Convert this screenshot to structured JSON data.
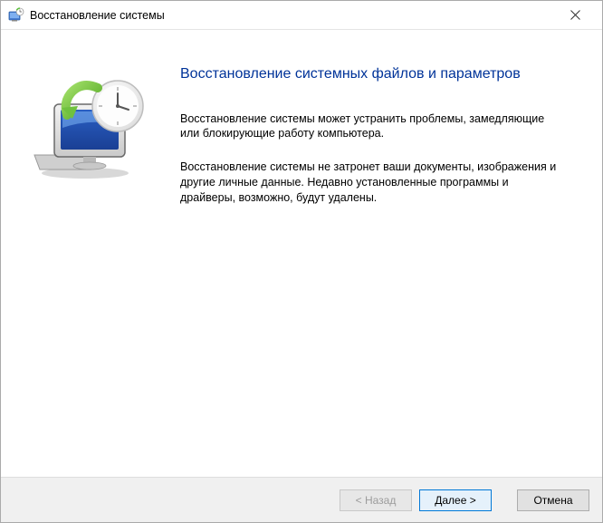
{
  "titlebar": {
    "text": "Восстановление системы"
  },
  "content": {
    "heading": "Восстановление системных файлов и параметров",
    "para1": "Восстановление системы может устранить проблемы, замедляющие или блокирующие работу компьютера.",
    "para2": "Восстановление системы не затронет ваши документы, изображения и другие личные данные. Недавно установленные программы и драйверы, возможно, будут удалены."
  },
  "footer": {
    "back": "< Назад",
    "next": "Далее >",
    "cancel": "Отмена"
  }
}
